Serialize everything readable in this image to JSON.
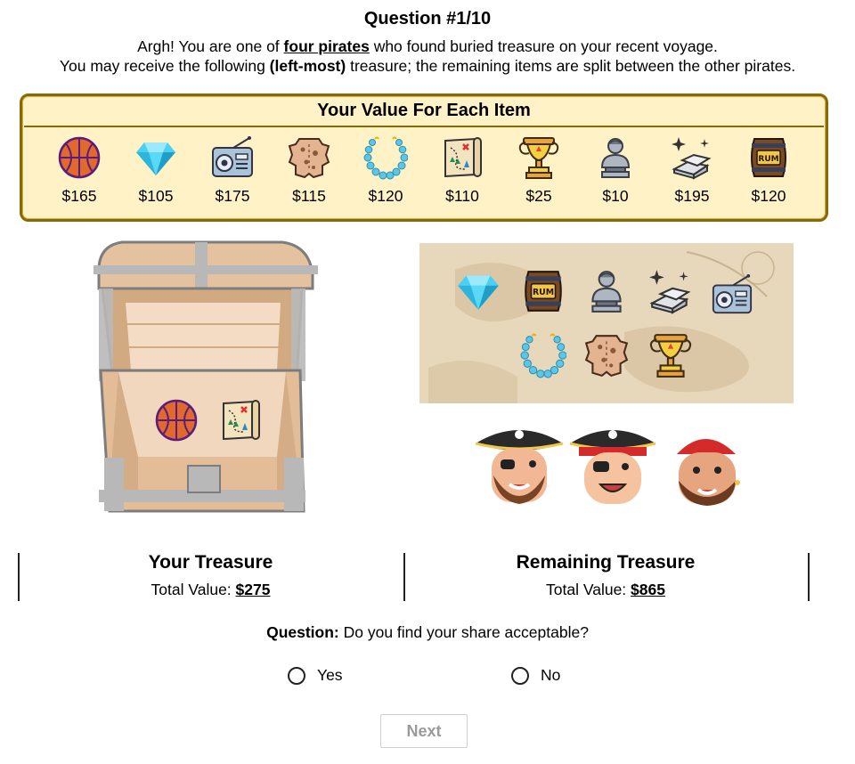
{
  "header": {
    "title": "Question #1/10",
    "line1_pre": "Argh! You are one of ",
    "line1_em": "four pirates",
    "line1_post": " who found buried treasure on your recent voyage.",
    "line2_pre": "You may receive the following ",
    "line2_em": "(left-most)",
    "line2_post": " treasure; the remaining items are split between the other pirates."
  },
  "value_table": {
    "heading": "Your Value For Each Item",
    "items": [
      {
        "icon": "basketball-icon",
        "price": "$165"
      },
      {
        "icon": "diamond-icon",
        "price": "$105"
      },
      {
        "icon": "radio-icon",
        "price": "$175"
      },
      {
        "icon": "leather-hide-icon",
        "price": "$115"
      },
      {
        "icon": "bead-necklace-icon",
        "price": "$120"
      },
      {
        "icon": "treasure-map-icon",
        "price": "$110"
      },
      {
        "icon": "trophy-chalice-icon",
        "price": "$25"
      },
      {
        "icon": "bust-statue-icon",
        "price": "$10"
      },
      {
        "icon": "silver-bars-icon",
        "price": "$195"
      },
      {
        "icon": "rum-barrel-icon",
        "price": "$120"
      }
    ]
  },
  "chest_items": [
    "basketball-icon",
    "treasure-map-icon"
  ],
  "map_items": [
    "diamond-icon",
    "rum-barrel-icon",
    "bust-statue-icon",
    "silver-bars-icon",
    "radio-icon",
    "bead-necklace-icon",
    "leather-hide-icon",
    "trophy-chalice-icon"
  ],
  "your_treasure": {
    "heading": "Your Treasure",
    "label": "Total Value: ",
    "value": "$275"
  },
  "remaining_treasure": {
    "heading": "Remaining Treasure",
    "label": "Total Value: ",
    "value": "$865"
  },
  "question": {
    "label": "Question:",
    "text": " Do you find your share acceptable?",
    "options": [
      "Yes",
      "No"
    ]
  },
  "next_label": "Next",
  "colors": {
    "box_bg": "#fff2c6",
    "box_border": "#8a6a00",
    "basketball": "#e2692d",
    "diamond": "#4cd0f2"
  }
}
